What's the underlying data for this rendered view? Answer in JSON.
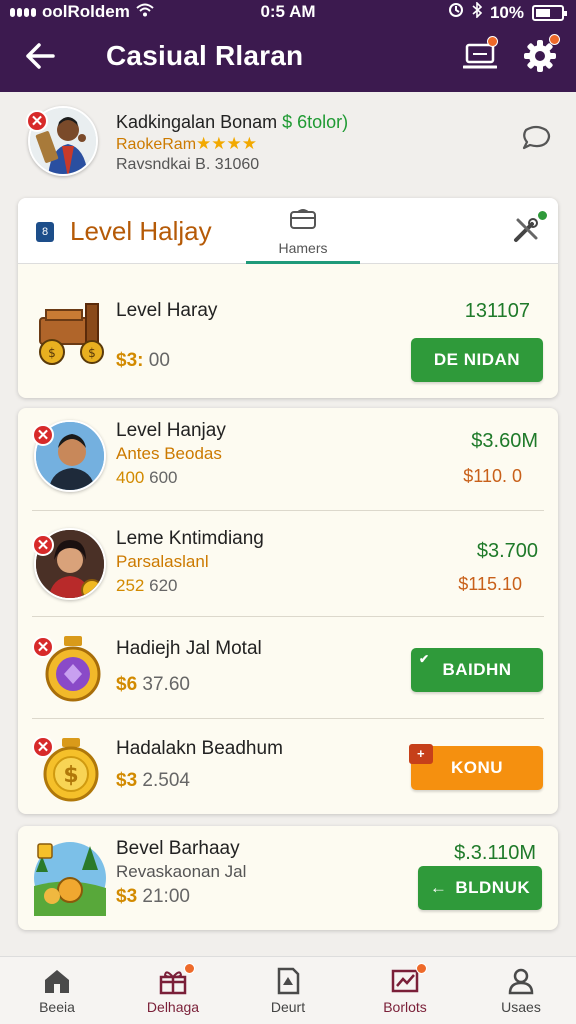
{
  "status_bar": {
    "carrier": "oolRoldem",
    "time": "0:5 AM",
    "battery": "10%"
  },
  "header": {
    "title": "Casiual Rlaran",
    "back_icon": "arrow-left-icon",
    "chat_icon": "laptop-chat-icon",
    "settings_icon": "gear-icon"
  },
  "profile": {
    "name": "Kadkingalan Bonam",
    "name_extra": "$ 6tolor)",
    "rank": "RaokeRam",
    "stars": "★★★★",
    "balance": "Ravsndkai B. 31060"
  },
  "tab_card": {
    "chip": "8",
    "title": "Level Haljay",
    "mid_tab_label": "Hamers"
  },
  "featured": {
    "title": "Level Haray",
    "amount_prefix": "$3:",
    "amount": "00",
    "right_value": "131107",
    "button_label": "DE NIDAN"
  },
  "list": [
    {
      "title": "Level Hanjay",
      "subtitle": "Antes Beodas",
      "amount_prefix": "400",
      "amount": "600",
      "right_top": "$3.60M",
      "right_bottom": "$110. 0"
    },
    {
      "title": "Leme Kntimdiang",
      "subtitle": "Parsalaslanl",
      "amount_prefix": "252",
      "amount": "620",
      "right_top": "$3.700",
      "right_bottom": "$115.10"
    },
    {
      "title": "Hadiejh Jal Motal",
      "amount_prefix": "$6",
      "amount": "37.60",
      "button_label": "BAIDHN"
    },
    {
      "title": "Hadalakn Beadhum",
      "amount_prefix": "$3",
      "amount": "2.504",
      "button_label": "KONU"
    }
  ],
  "bottom_card": {
    "title": "Bevel Barhaay",
    "subtitle": "Revaskaonan Jal",
    "amount_prefix": "$3",
    "amount": "21:00",
    "right_top": "$.3.110M",
    "button_label": "BLDNUK"
  },
  "nav": [
    {
      "label": "Beeia",
      "icon": "home-icon"
    },
    {
      "label": "Delhaga",
      "icon": "gift-icon",
      "badge": true
    },
    {
      "label": "Deurt",
      "icon": "document-icon"
    },
    {
      "label": "Borlots",
      "icon": "chart-icon",
      "badge": true
    },
    {
      "label": "Usaes",
      "icon": "user-icon"
    }
  ],
  "colors": {
    "appbar": "#3c1a4f",
    "green_button": "#2f9a3a",
    "orange_button": "#f5900f",
    "gold_text": "#d28a00",
    "badge_red": "#d72a2a"
  }
}
